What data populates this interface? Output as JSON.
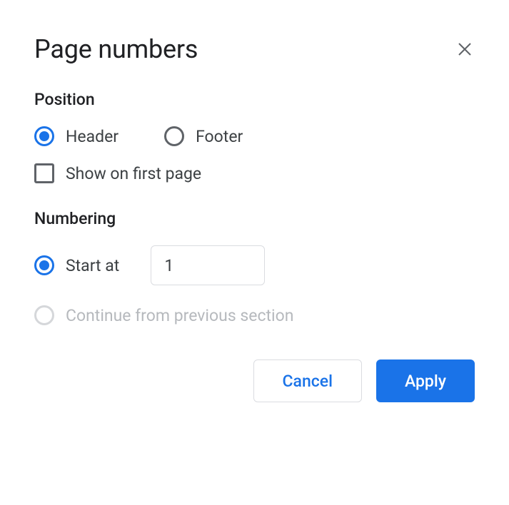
{
  "dialog": {
    "title": "Page numbers"
  },
  "position": {
    "title": "Position",
    "header_label": "Header",
    "footer_label": "Footer",
    "selected": "header",
    "show_first_label": "Show on first page",
    "show_first_checked": false
  },
  "numbering": {
    "title": "Numbering",
    "start_at_label": "Start at",
    "start_at_value": "1",
    "continue_label": "Continue from previous section",
    "selected": "start_at",
    "continue_disabled": true
  },
  "actions": {
    "cancel": "Cancel",
    "apply": "Apply"
  }
}
